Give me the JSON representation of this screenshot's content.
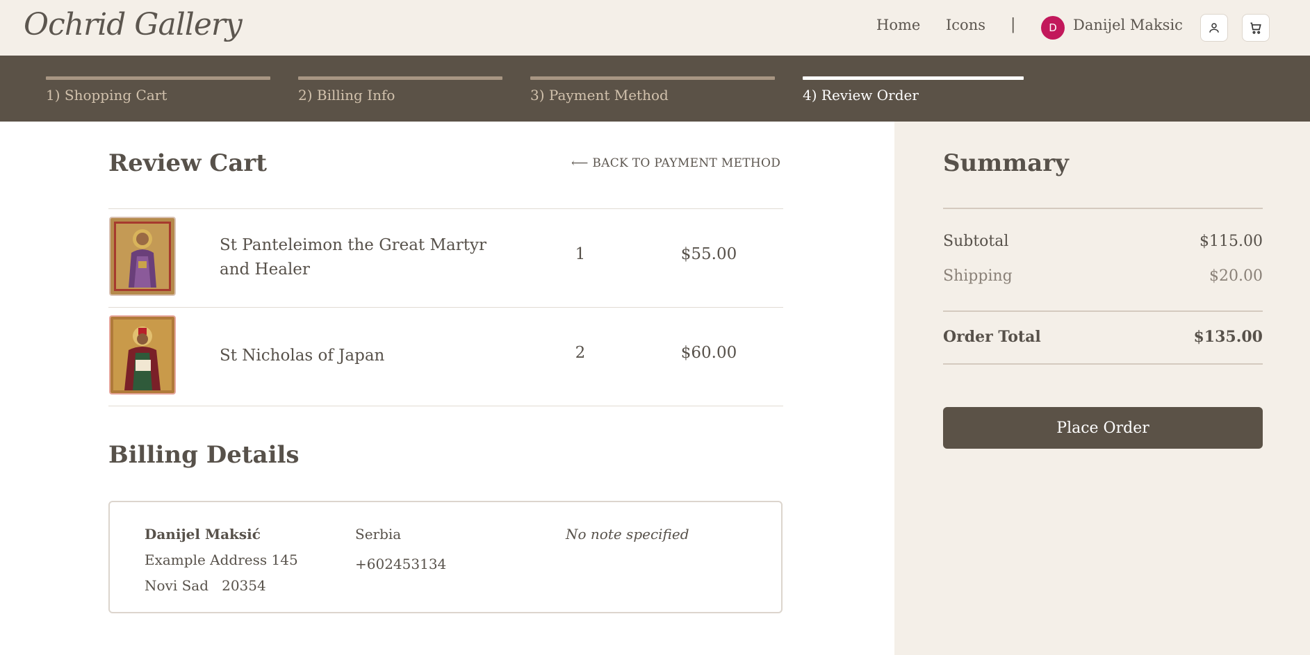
{
  "header": {
    "logo": "Ochrid Gallery",
    "nav": [
      {
        "label": "Home"
      },
      {
        "label": "Icons"
      }
    ],
    "separator": "|",
    "user": {
      "initial": "D",
      "name": "Danijel Maksic",
      "avatar_color": "#c2185b"
    }
  },
  "steps": [
    {
      "label": "1) Shopping Cart",
      "active": false
    },
    {
      "label": "2) Billing Info",
      "active": false
    },
    {
      "label": "3) Payment Method",
      "active": false
    },
    {
      "label": "4) Review Order",
      "active": true
    }
  ],
  "review": {
    "title": "Review Cart",
    "back_link": "⟵ BACK TO PAYMENT METHOD",
    "items": [
      {
        "name": "St Panteleimon the Great Martyr and Healer",
        "qty": "1",
        "price": "$55.00",
        "image": "icon-panteleimon"
      },
      {
        "name": "St Nicholas of Japan",
        "qty": "2",
        "price": "$60.00",
        "image": "icon-nicholas"
      }
    ]
  },
  "billing": {
    "title": "Billing Details",
    "name": "Danijel Maksić",
    "address": "Example Address 145",
    "city": "Novi Sad",
    "zip": "20354",
    "country": "Serbia",
    "phone": "+602453134",
    "note": "No note specified"
  },
  "summary": {
    "title": "Summary",
    "subtotal_label": "Subtotal",
    "subtotal": "$115.00",
    "shipping_label": "Shipping",
    "shipping": "$20.00",
    "total_label": "Order Total",
    "total": "$135.00",
    "place_order": "Place Order"
  },
  "colors": {
    "accent": "#5b5247",
    "background": "#f4efe8"
  }
}
